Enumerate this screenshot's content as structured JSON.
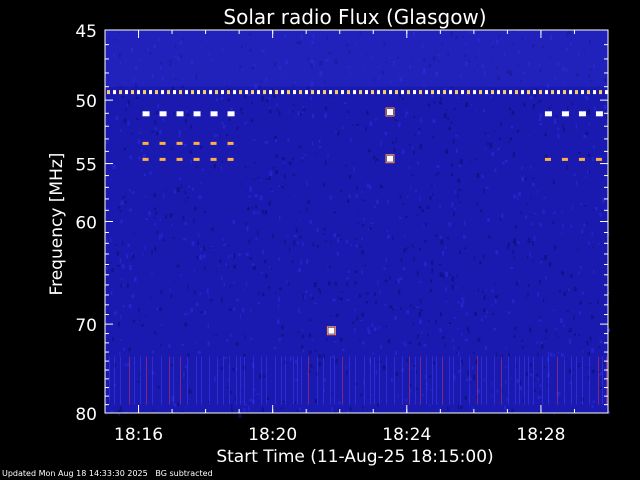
{
  "chart_data": {
    "type": "heatmap",
    "title": "Solar radio Flux (Glasgow)",
    "xlabel": "Start Time (11-Aug-25 18:15:00)",
    "ylabel": "Frequency [MHz]",
    "y_ticks": [
      45,
      50,
      55,
      60,
      70,
      80
    ],
    "y_range": [
      45,
      80
    ],
    "y_scale": "log",
    "x_ticks": [
      "18:16",
      "18:20",
      "18:24",
      "18:28"
    ],
    "x_range_minutes_after_1815": [
      0,
      15
    ],
    "colormap": "blue-background with yellow/white bursts",
    "background_color": "#1a1ab0",
    "events": [
      {
        "label": "narrowband line",
        "freq_mhz": 49.4,
        "time_span": [
          "18:15",
          "18:30"
        ]
      },
      {
        "label": "intermittent emission",
        "freq_mhz": 51.0,
        "time_span": [
          "18:16",
          "18:19"
        ]
      },
      {
        "label": "intermittent emission",
        "freq_mhz": 53.4,
        "time_span": [
          "18:16",
          "18:19"
        ]
      },
      {
        "label": "intermittent emission",
        "freq_mhz": 54.7,
        "time_span": [
          "18:16",
          "18:19"
        ]
      },
      {
        "label": "intermittent emission",
        "freq_mhz": 51.0,
        "time_span": [
          "18:28",
          "18:30"
        ]
      },
      {
        "label": "intermittent emission",
        "freq_mhz": 54.7,
        "time_span": [
          "18:28",
          "18:30"
        ]
      },
      {
        "label": "spot",
        "freq_mhz": 70.7,
        "time": "18:21:45"
      },
      {
        "label": "spot",
        "freq_mhz": 50.9,
        "time": "18:23:30"
      },
      {
        "label": "spot",
        "freq_mhz": 54.6,
        "time": "18:23:30"
      }
    ]
  },
  "footer": {
    "updated": "Updated Mon Aug 18 14:33:30 2025",
    "mode": "BG subtracted"
  }
}
